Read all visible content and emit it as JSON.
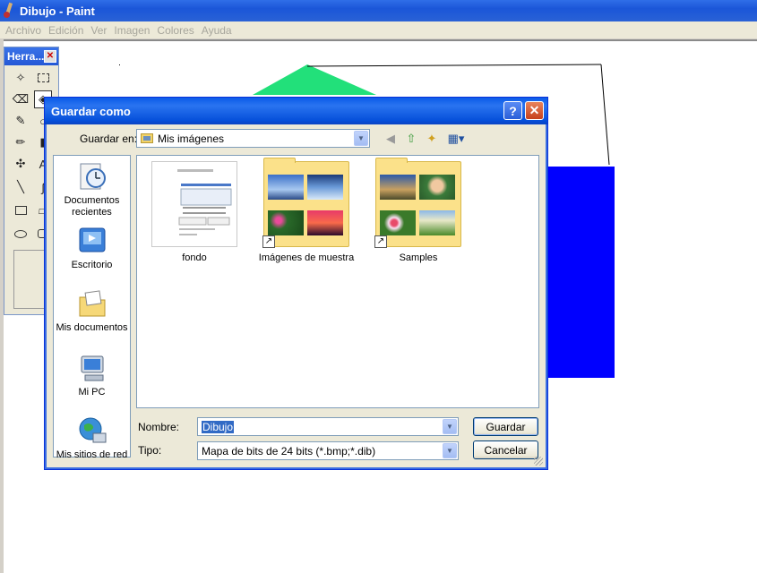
{
  "paint": {
    "title": "Dibujo - Paint",
    "menu": [
      "Archivo",
      "Edición",
      "Ver",
      "Imagen",
      "Colores",
      "Ayuda"
    ],
    "tools_title": "Herra...",
    "tools_close": "✕",
    "colors": {
      "green_shape": "#22e07a",
      "blue_shape": "#0000ff"
    }
  },
  "dialog": {
    "title": "Guardar como",
    "help_label": "?",
    "close_label": "✕",
    "save_in_label": "Guardar en:",
    "save_in_value": "Mis imágenes",
    "places": [
      {
        "label": "Documentos recientes",
        "icon": "recent-documents-icon"
      },
      {
        "label": "Escritorio",
        "icon": "desktop-icon"
      },
      {
        "label": "Mis documentos",
        "icon": "my-documents-icon"
      },
      {
        "label": "Mi PC",
        "icon": "my-computer-icon"
      },
      {
        "label": "Mis sitios de red",
        "icon": "network-places-icon"
      }
    ],
    "files": [
      {
        "name": "fondo",
        "type": "document"
      },
      {
        "name": "Imágenes de muestra",
        "type": "folder-shortcut"
      },
      {
        "name": "Samples",
        "type": "folder-shortcut"
      }
    ],
    "name_label": "Nombre:",
    "name_value": "Dibujo",
    "type_label": "Tipo:",
    "type_value": "Mapa de bits de 24 bits (*.bmp;*.dib)",
    "save_button": "Guardar",
    "cancel_button": "Cancelar"
  }
}
